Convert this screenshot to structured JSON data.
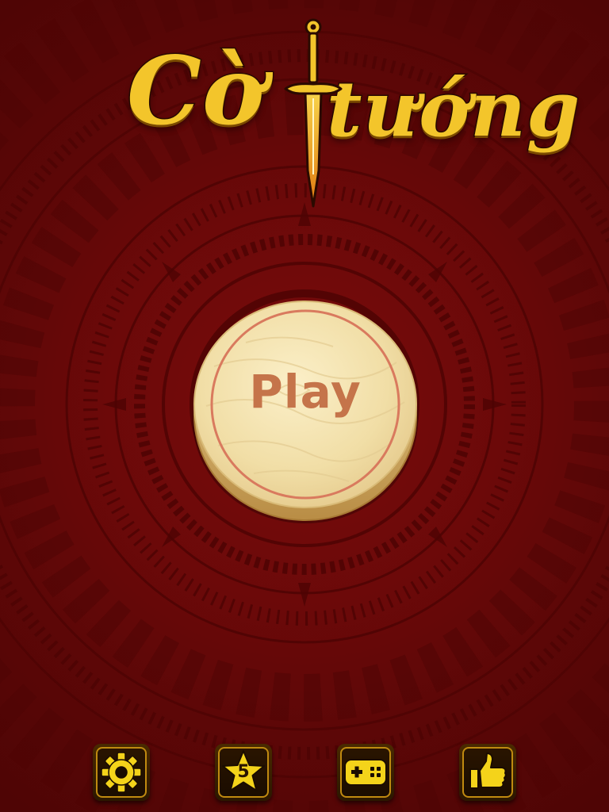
{
  "title": {
    "word_1": "Cờ",
    "word_2": "tướng"
  },
  "play_button": {
    "label": "Play"
  },
  "toolbar": {
    "settings_icon": "gear-icon",
    "rate_icon": "star-icon",
    "rate_count": "5",
    "more_games_icon": "gamepad-icon",
    "like_icon": "thumbs-up-icon"
  },
  "colors": {
    "background": "#6b0909",
    "title_gold": "#f3c52b",
    "wood": "#f1dea6",
    "play_text": "#c5744a",
    "icon_gold": "#f4d31a"
  }
}
